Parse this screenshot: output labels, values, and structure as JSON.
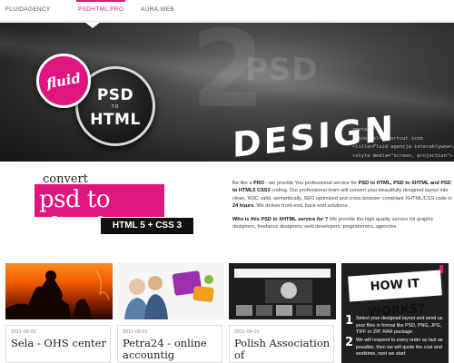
{
  "nav": {
    "items": [
      {
        "label": "FLUIDAGENCY"
      },
      {
        "label": "PSDHTML.PRO"
      },
      {
        "label": "AURA.WEB"
      }
    ],
    "active_index": 1
  },
  "hero": {
    "badge_label": "fluid",
    "circle_line1": "PSD",
    "circle_line2": "TO",
    "circle_line3": "HTML",
    "big_number": "2",
    "big_psd": "PSD",
    "design_word": "DESIGN",
    "code_lines": "<meta\n<link rel=\"shortcut icon\n<title>Fluid agencja interaktywna</ti\n<style media=\"screen, projection\"> @imp"
  },
  "intro": {
    "convert_label": "convert",
    "psd_xhtml_label": "psd to xhtml",
    "html_css_label": "HTML 5 + CSS 3",
    "paragraph1_parts": [
      {
        "text": "Be like a ",
        "bold": false
      },
      {
        "text": "PRO",
        "bold": true
      },
      {
        "text": " - we provide You professional service for ",
        "bold": false
      },
      {
        "text": "PSD to HTML, PSD to XHTML and PSD to HTML5 CSS3",
        "bold": true
      },
      {
        "text": " coding. Our professional team will convert your beautifully designed layout into clean, W3C valid, semantically, SEO optimized and cross browser compliant XHTML/CSS code in ",
        "bold": false
      },
      {
        "text": "24 hours",
        "bold": true
      },
      {
        "text": ". We deliver front-end, back-end solutions.",
        "bold": false
      }
    ],
    "paragraph2_parts": [
      {
        "text": "Who is this PSD to XHTML service for ?",
        "bold": true
      },
      {
        "text": " We provide the high quality service for graphic designers, freelance designers, web developers, programmers, agencies.",
        "bold": false
      }
    ]
  },
  "portfolio": [
    {
      "date": "2011-09-01",
      "title": "Sela - OHS center"
    },
    {
      "date": "2011-09-01",
      "title": "Petra24 - online accountig"
    },
    {
      "date": "2011-04-01",
      "title": "Polish Association of"
    }
  ],
  "how_it_works": {
    "title": "HOW IT WORKS?",
    "steps": [
      {
        "number": "1",
        "text": "Select your designed layout and send us your files in format like PSD, PNG, JPG, TIFF or ZIP, RAR package"
      },
      {
        "number": "2",
        "text": "We will respond to every order as fast as possible, then we will quote the cost and worktime, next we start"
      }
    ]
  },
  "colors": {
    "accent_pink": "#e0157e",
    "dark": "#1f1f1f"
  }
}
